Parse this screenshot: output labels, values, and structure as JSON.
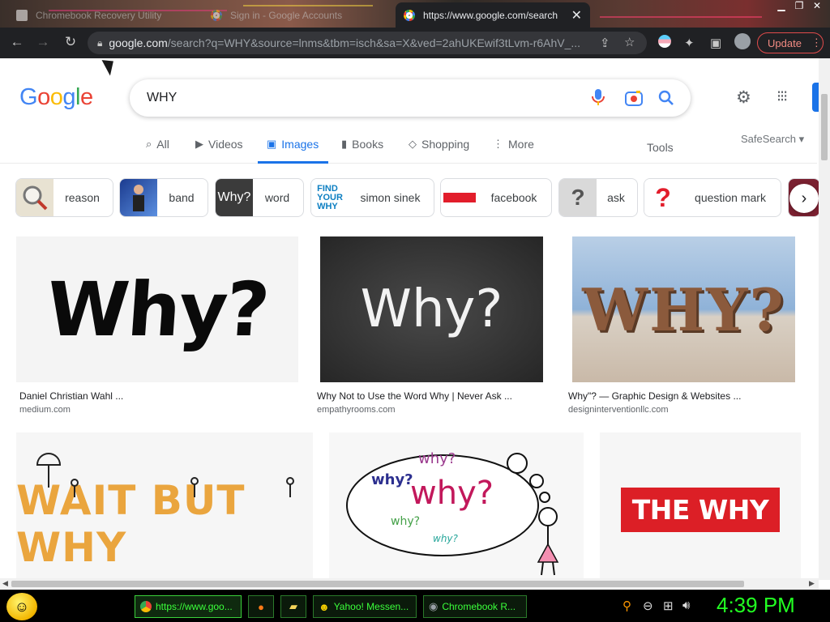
{
  "browser": {
    "tabs": [
      {
        "title": "Chromebook Recovery Utility",
        "active": false
      },
      {
        "title": "Sign in - Google Accounts",
        "active": false
      },
      {
        "title": "https://www.google.com/search",
        "active": true
      }
    ],
    "omnibox": {
      "domain": "google.com",
      "path": "/search?q=WHY&source=lnms&tbm=isch&sa=X&ved=2ahUKEwif3tLvm-r6AhV_..."
    },
    "update_label": "Update",
    "accent_color": "#e24b4b"
  },
  "google": {
    "logo": [
      "G",
      "o",
      "o",
      "g",
      "l",
      "e"
    ],
    "query": "WHY",
    "tabs": [
      {
        "label": "All",
        "icon": "search-icon"
      },
      {
        "label": "Videos",
        "icon": "video-icon"
      },
      {
        "label": "Images",
        "icon": "image-icon"
      },
      {
        "label": "Books",
        "icon": "book-icon"
      },
      {
        "label": "Shopping",
        "icon": "tag-icon"
      },
      {
        "label": "More",
        "icon": "more-vert-icon"
      }
    ],
    "active_tab": "Images",
    "tools_label": "Tools",
    "safesearch_label": "SafeSearch",
    "chips": [
      "reason",
      "band",
      "word",
      "simon sinek",
      "facebook",
      "ask",
      "question mark"
    ],
    "results": [
      {
        "caption": "Daniel Christian Wahl ...",
        "source": "medium.com",
        "image_text": "Why?"
      },
      {
        "caption": "Why Not to Use the Word Why | Never Ask ...",
        "source": "empathyrooms.com",
        "image_text": "Why?"
      },
      {
        "caption": "Why\"? — Graphic Design & Websites ...",
        "source": "designinterventionllc.com",
        "image_text": "WHY?"
      },
      {
        "caption": "",
        "source": "",
        "image_text": "WAIT BUT WHY"
      },
      {
        "caption": "",
        "source": "",
        "image_text": "why?"
      },
      {
        "caption": "",
        "source": "",
        "image_text": "THE WHY"
      }
    ],
    "cloud_words": [
      "why?",
      "why?",
      "why?",
      "why?",
      "why?"
    ]
  },
  "taskbar": {
    "tasks": [
      {
        "label": "https://www.goo...",
        "icon": "chrome-icon",
        "active": true
      },
      {
        "label": "",
        "icon": "firefox-icon",
        "active": false
      },
      {
        "label": "",
        "icon": "folder-icon",
        "active": false
      },
      {
        "label": "Yahoo! Messen...",
        "icon": "smiley-icon",
        "active": false
      },
      {
        "label": "Chromebook R...",
        "icon": "recovery-icon",
        "active": false
      }
    ],
    "clock": "4:39 PM",
    "clock_color": "#22ff22"
  }
}
